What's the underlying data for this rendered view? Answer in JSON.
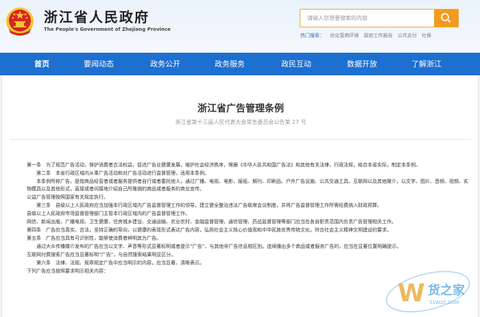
{
  "header": {
    "title": "浙江省人民政府",
    "subtitle": "The People's Government of Zhejiang Province",
    "search_placeholder": "请输入您想要搜索的内容",
    "hot_label": "热门搜索：",
    "hot_links": [
      "优化营商环境",
      "政府工作报告",
      "公共支付",
      "社保"
    ]
  },
  "nav": {
    "items": [
      "首页",
      "要闻动态",
      "政务公开",
      "政务服务",
      "政民互动",
      "数据开放",
      "了解浙江"
    ]
  },
  "article": {
    "title": "浙江省广告管理条例",
    "subtitle": "浙江省第十三届人民代表大会常务委员会公告第 27 号",
    "paragraphs": [
      "第一条　为了规范广告活动，保护消费者合法权益，促进广告业健康发展，维护社会经济秩序，根据《中华人民共和国广告法》和其他有关法律、行政法规，结合本省实际，制定本条例。",
      "第二条　本省行政区域内从事广告活动和对广告活动进行监督管理，适用本条例。",
      "本条例所称广告，是指商品经营者或者服务提供者自行或者委托他人，通过广播、电视、电影、报纸、期刊、印刷品、户外广告设施、公共交通工具、互联网以及其他媒介，以文字、图片、音频、视频、实物模具以及其他形式，直接或者间接地介绍自己所推销的商品或者服务的商业宣传。",
      "公益广告管理按照国家有关规定执行。",
      "第三条　县级以上人民政府应当加强本行政区域内广告监督管理工作的领导，建立健全整治违法广告联席会议制度，并将广告监督管理工作所需经费纳入财政预算。",
      "县级以上人民政府市场监督管理部门主管本行政区域内的广告监督管理工作。",
      "网信、新闻出版、广播电视、卫生健康、住房城乡建设、交通运输、农业农村、金融监督管理、通信管理、药品监督管理等部门应当在各自职责范围内负责广告管理相关工作。",
      "第四条　广告应当真实、合法，坚持正确的导向，以健康的表现形式表达广告内容，弘扬社会主义核心价值观和中华民族优秀传统文化，符合社会主义精神文明建设的要求。",
      "第五条　广告应当具有可识别性，能够使消费者辨明其为广告。",
      "通过大众传播媒介发布的广告应当以文字、声音等形式显著标明或者提示“广告”，与其他非广告信息相区别。连续播出多个商品或者服务广告的，应当在显著位置明确提示。",
      "互联网付费搜索广告应当显著标明“广告”，与自然搜索结果明显区分。",
      "第六条　法律、法规、规章规定广告中应当明示的内容，应当显著、清晰表示。",
      "下列广告应当按照要求明示相关内容："
    ]
  },
  "watermark": {
    "brand": "货之家",
    "domain": "51W2C.COM"
  },
  "colors": {
    "nav_bg": "#1d6fd0",
    "search_accent": "#f39a1f",
    "hot_label": "#2d6fc2",
    "emblem_red": "#d7261e",
    "emblem_gold": "#f3c43b"
  }
}
